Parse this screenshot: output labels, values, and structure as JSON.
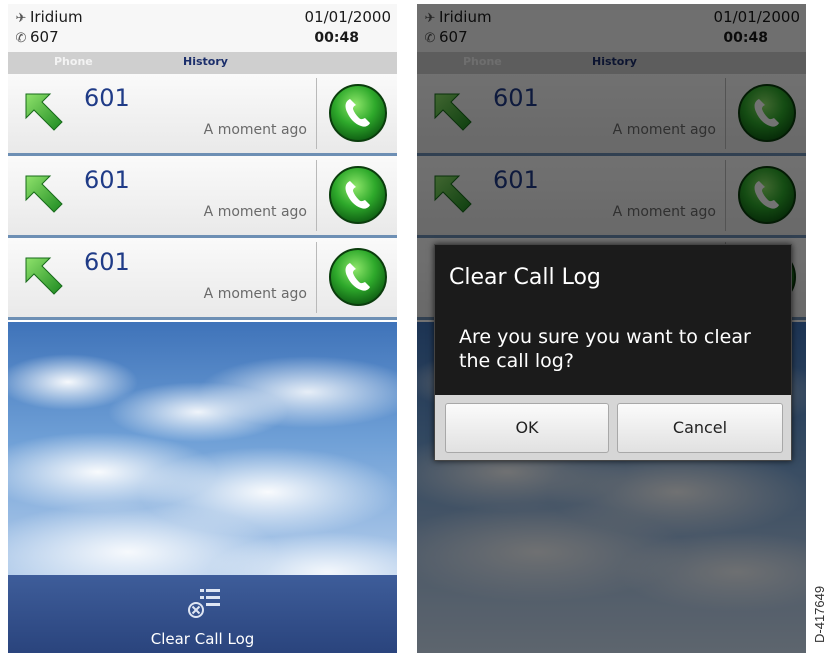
{
  "status": {
    "carrier": "Iridium",
    "line": "607",
    "date": "01/01/2000",
    "time": "00:48"
  },
  "tabs": {
    "phone": "Phone",
    "history": "History"
  },
  "calls": [
    {
      "number": "601",
      "when": "A moment ago",
      "direction": "outgoing"
    },
    {
      "number": "601",
      "when": "A moment ago",
      "direction": "outgoing"
    },
    {
      "number": "601",
      "when": "A moment ago",
      "direction": "outgoing"
    }
  ],
  "bottom_bar": {
    "clear_label": "Clear Call Log",
    "icon": "clear-list-icon"
  },
  "dialog": {
    "title": "Clear Call Log",
    "message": "Are you sure you want to clear the call log?",
    "ok": "OK",
    "cancel": "Cancel"
  },
  "figure_id": "D-417649",
  "colors": {
    "accent_blue": "#1f3b87",
    "call_green": "#2aa81f",
    "tab_active": "#1b2e6b"
  }
}
